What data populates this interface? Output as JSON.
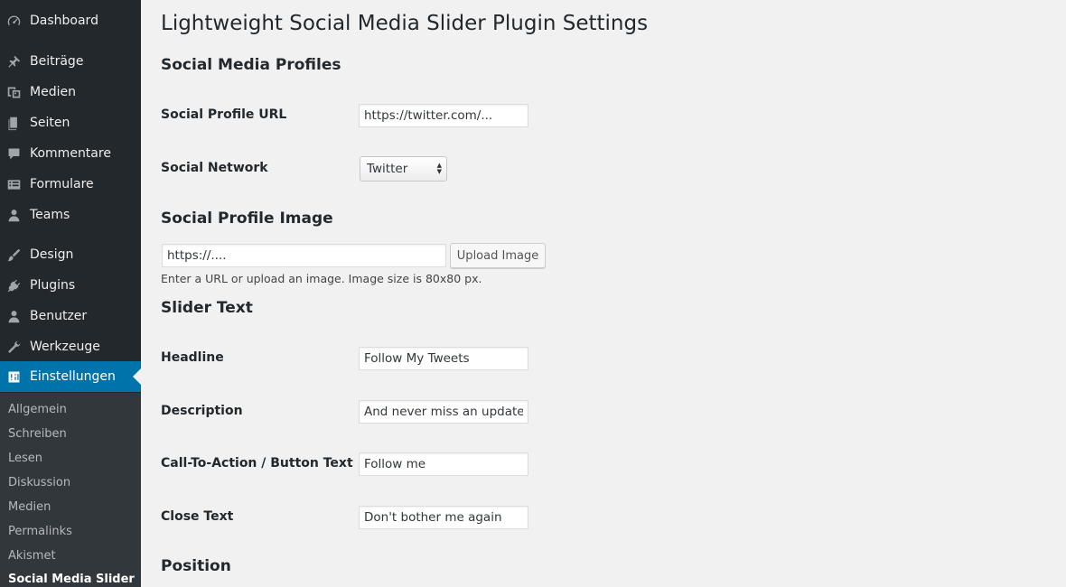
{
  "sidebar": {
    "items": [
      {
        "label": "Dashboard",
        "icon": "dashboard-icon"
      },
      {
        "label": "Beiträge",
        "icon": "pin-icon"
      },
      {
        "label": "Medien",
        "icon": "media-icon"
      },
      {
        "label": "Seiten",
        "icon": "pages-icon"
      },
      {
        "label": "Kommentare",
        "icon": "comment-icon"
      },
      {
        "label": "Formulare",
        "icon": "form-icon"
      },
      {
        "label": "Teams",
        "icon": "team-icon"
      },
      {
        "label": "Design",
        "icon": "brush-icon"
      },
      {
        "label": "Plugins",
        "icon": "plugin-icon"
      },
      {
        "label": "Benutzer",
        "icon": "user-icon"
      },
      {
        "label": "Werkzeuge",
        "icon": "wrench-icon"
      },
      {
        "label": "Einstellungen",
        "icon": "settings-sliders-icon"
      }
    ],
    "submenu": [
      {
        "label": "Allgemein"
      },
      {
        "label": "Schreiben"
      },
      {
        "label": "Lesen"
      },
      {
        "label": "Diskussion"
      },
      {
        "label": "Medien"
      },
      {
        "label": "Permalinks"
      },
      {
        "label": "Akismet"
      },
      {
        "label": "Social Media Slider"
      }
    ],
    "colors": {
      "background": "#23282d",
      "submenu_background": "#32373c",
      "active": "#0073aa"
    }
  },
  "main": {
    "page_title": "Lightweight Social Media Slider Plugin Settings",
    "sections": {
      "profiles": {
        "title": "Social Media Profiles",
        "profile_url_label": "Social Profile URL",
        "profile_url_value": "https://twitter.com/...",
        "network_label": "Social Network",
        "network_selected": "Twitter"
      },
      "image": {
        "title": "Social Profile Image",
        "url_value": "https://....",
        "upload_button": "Upload Image",
        "description": "Enter a URL or upload an image. Image size is 80x80 px."
      },
      "slider_text": {
        "title": "Slider Text",
        "headline_label": "Headline",
        "headline_value": "Follow My Tweets",
        "description_label": "Description",
        "description_value": "And never miss an update.",
        "cta_label": "Call-To-Action / Button Text",
        "cta_value": "Follow me",
        "close_label": "Close Text",
        "close_value": "Don't bother me again"
      },
      "position": {
        "title": "Position"
      }
    }
  }
}
